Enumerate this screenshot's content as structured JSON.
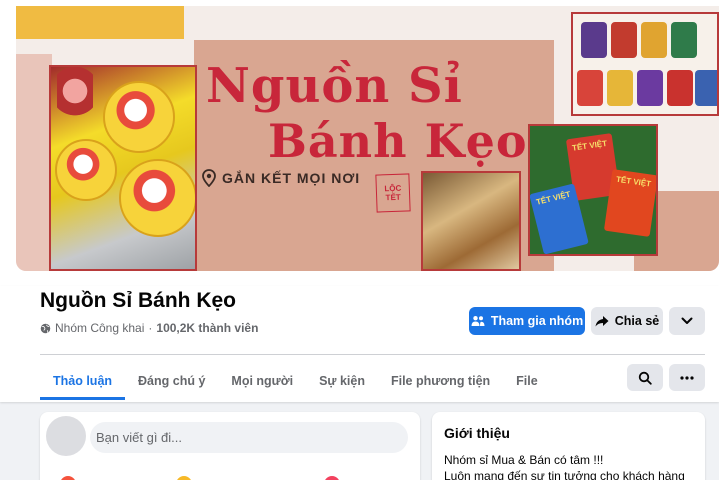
{
  "cover": {
    "title_line1": "Nguồn Sỉ",
    "title_line2": "Bánh Kẹo",
    "tagline": "GẮN KẾT MỌI NƠI",
    "stamp_text": "LỘC TẾT",
    "envelope_text": "TẾT VIỆT",
    "colors": {
      "title_red": "#c8263a",
      "accent_yellow": "#f0bb42",
      "block_pink": "#d9a691"
    }
  },
  "group": {
    "name": "Nguồn Sỉ Bánh Kẹo",
    "privacy": "Nhóm Công khai",
    "separator": "·",
    "members": "100,2K thành viên"
  },
  "actions": {
    "join_label": "Tham gia nhóm",
    "share_label": "Chia sẻ",
    "join_color": "#1b74e4"
  },
  "tabs": [
    {
      "label": "Thảo luận",
      "active": true
    },
    {
      "label": "Đáng chú ý",
      "active": false
    },
    {
      "label": "Mọi người",
      "active": false
    },
    {
      "label": "Sự kiện",
      "active": false
    },
    {
      "label": "File phương tiện",
      "active": false
    },
    {
      "label": "File",
      "active": false
    }
  ],
  "composer": {
    "placeholder": "Bạn viết gì đi..."
  },
  "intro": {
    "title": "Giới thiệu",
    "line1": "Nhóm sỉ Mua & Bán có tâm !!!",
    "line2": "Luôn mang đến sự tin tưởng cho khách hàng"
  }
}
